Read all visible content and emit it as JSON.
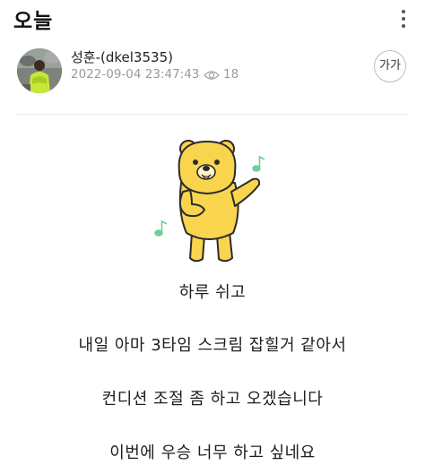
{
  "header": {
    "title": "오늘",
    "more_icon": "more-vertical-icon"
  },
  "post": {
    "author": "성훈-(dkel3535)",
    "datetime": "2022-09-04 23:47:43",
    "views": "18",
    "view_icon": "eye-icon",
    "font_size_label": "가가"
  },
  "content": {
    "sticker": "dancing-yellow-bear-sticker",
    "lines": [
      "하루 쉬고",
      "내일 아마 3타임 스크림 잡힐거 같아서",
      "컨디션 조절 좀 하고 오겠습니다",
      "이번에 우승 너무 하고 싶네요"
    ]
  },
  "colors": {
    "bear_body": "#f9d54e",
    "bear_outline": "#2b2b2b",
    "music_note": "#6ecf9a",
    "meta_text": "#9a9a9a",
    "divider": "#ececec"
  }
}
